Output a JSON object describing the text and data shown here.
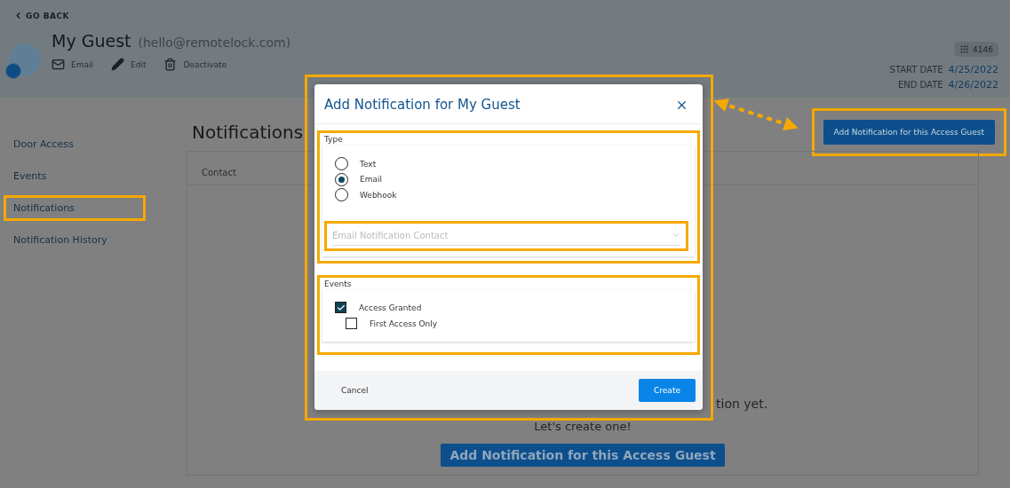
{
  "back_link": "GO BACK",
  "guest": {
    "name": "My Guest",
    "email": "(hello@remotelock.com)",
    "actions": [
      {
        "label": "Email",
        "kind": "mail"
      },
      {
        "label": "Edit",
        "kind": "edit"
      },
      {
        "label": "Deactivate",
        "kind": "trash"
      }
    ]
  },
  "pin_badge": "4146",
  "dates": [
    {
      "label": "START DATE",
      "value": "4/25/2022"
    },
    {
      "label": "END DATE",
      "value": "4/26/2022"
    }
  ],
  "sidebar": {
    "items": [
      {
        "label": "Door Access",
        "highlighted": false
      },
      {
        "label": "Events",
        "highlighted": false
      },
      {
        "label": "Notifications",
        "highlighted": true
      },
      {
        "label": "Notification History",
        "highlighted": false
      }
    ]
  },
  "page_title": "Notifications",
  "header_button": {
    "label": "Add Notification for this Access Guest",
    "highlighted": true
  },
  "table": {
    "columns": [
      "Contact"
    ]
  },
  "empty_state": {
    "lines": [
      "tion yet.",
      "Let's create one!"
    ],
    "button": "Add Notification for this Access Guest"
  },
  "modal": {
    "title": "Add Notification for My Guest",
    "highlighted": true,
    "type_section": {
      "label": "Type",
      "highlighted": true,
      "options": [
        {
          "label": "Text",
          "selected": false
        },
        {
          "label": "Email",
          "selected": true
        },
        {
          "label": "Webhook",
          "selected": false
        }
      ],
      "select": {
        "placeholder": "Email Notification Contact",
        "highlighted": true
      }
    },
    "events_section": {
      "label": "Events",
      "highlighted": true,
      "items": [
        {
          "label": "Access Granted",
          "checked": true,
          "children": [
            {
              "label": "First Access Only",
              "checked": false
            }
          ]
        }
      ]
    },
    "cancel": "Cancel",
    "create": "Create"
  }
}
